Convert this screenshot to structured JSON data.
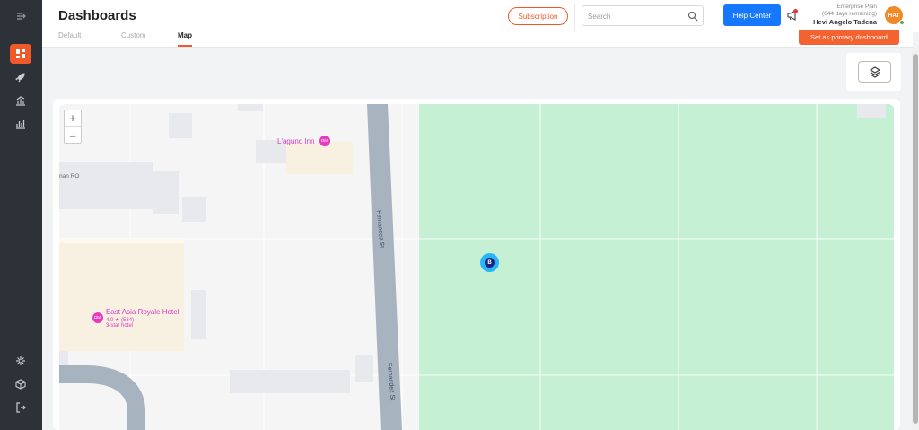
{
  "header": {
    "title": "Dashboards",
    "subscription_label": "Subscription",
    "search_placeholder": "Search",
    "help_label": "Help Center",
    "plan_name": "Enterprise Plan",
    "plan_remaining": "(644 days remaining)",
    "user_name": "Hevi Angelo Tadena",
    "avatar_initials": "HAT"
  },
  "tabs": [
    {
      "label": "Default",
      "active": false
    },
    {
      "label": "Custom",
      "active": false
    },
    {
      "label": "Map",
      "active": true
    }
  ],
  "primary_dashboard_label": "Set as primary dashboard",
  "sidebar": {
    "items": [
      {
        "icon": "menu-icon"
      },
      {
        "icon": "dashboard-grid-icon",
        "active": true
      },
      {
        "icon": "rocket-icon"
      },
      {
        "icon": "chart-up-icon"
      },
      {
        "icon": "bar-chart-icon"
      },
      {
        "icon": "gear-icon"
      },
      {
        "icon": "cube-icon"
      },
      {
        "icon": "logout-icon"
      }
    ]
  },
  "map": {
    "zoom_in": "+",
    "zoom_out": "−",
    "pois": [
      {
        "name": "L'aguno Inn",
        "badge": "DM"
      },
      {
        "name": "East Asia Royale Hotel",
        "badge": "DM",
        "rating": "4.0 ★ (534)",
        "category": "3-star hotel"
      }
    ],
    "area_label": "nan RO",
    "streets": [
      "Fernandez St",
      "Fernandez St"
    ],
    "marker_label": "B"
  },
  "colors": {
    "accent": "#f05a28",
    "help_blue": "#1677ff",
    "park_green": "#c5f0d3",
    "marker_blue": "#29b6f6",
    "sidebar_bg": "#2d3238"
  }
}
